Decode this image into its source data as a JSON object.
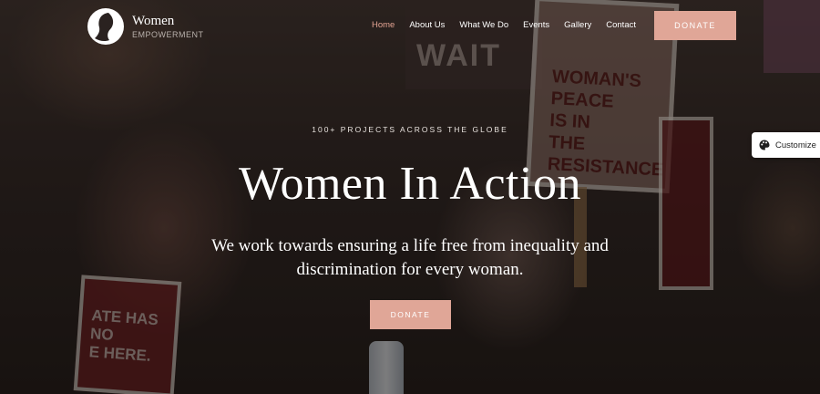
{
  "brand": {
    "name": "Women",
    "tagline": "EMPOWERMENT"
  },
  "nav": {
    "items": [
      {
        "label": "Home",
        "active": true
      },
      {
        "label": "About Us"
      },
      {
        "label": "What We Do"
      },
      {
        "label": "Events"
      },
      {
        "label": "Gallery"
      },
      {
        "label": "Contact"
      }
    ],
    "donate_label": "DONATE"
  },
  "hero": {
    "eyebrow": "100+ PROJECTS ACROSS THE GLOBE",
    "title": "Women In Action",
    "subtitle": "We work towards ensuring a life free from inequality and discrimination for every woman.",
    "donate_label": "DONATE"
  },
  "background_signs": {
    "left": "ATE HAS NO\nE HERE.",
    "top": "WAIT",
    "right": "WOMAN'S\nPEACE\nIS IN\nTHE\nRESISTANCE"
  },
  "customize": {
    "label": "Customize",
    "icon": "palette-icon"
  },
  "colors": {
    "accent": "#e0a697",
    "active_nav": "#e3a392",
    "text": "#ffffff"
  }
}
